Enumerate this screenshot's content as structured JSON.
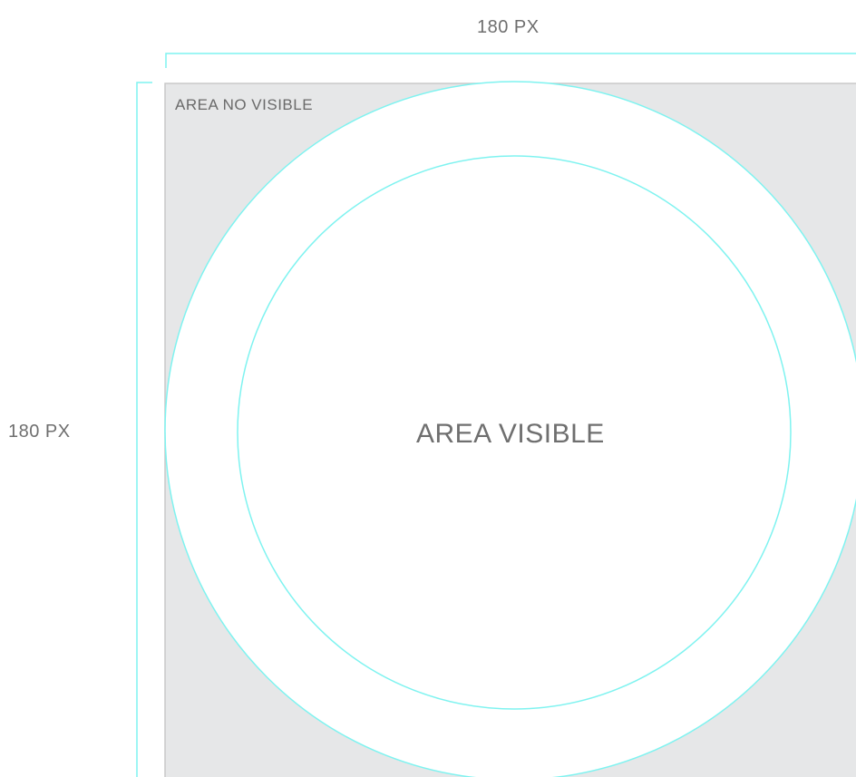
{
  "dimensions": {
    "width_label": "180 PX",
    "height_label": "180 PX"
  },
  "areas": {
    "not_visible_label": "AREA  NO VISIBLE",
    "visible_label": "AREA VISIBLE"
  },
  "colors": {
    "guide_line": "#7ff3f0",
    "not_visible_fill": "#e6e7e8",
    "visible_fill": "#ffffff",
    "square_border": "#c8c8c8",
    "text": "#6f6f6f"
  }
}
